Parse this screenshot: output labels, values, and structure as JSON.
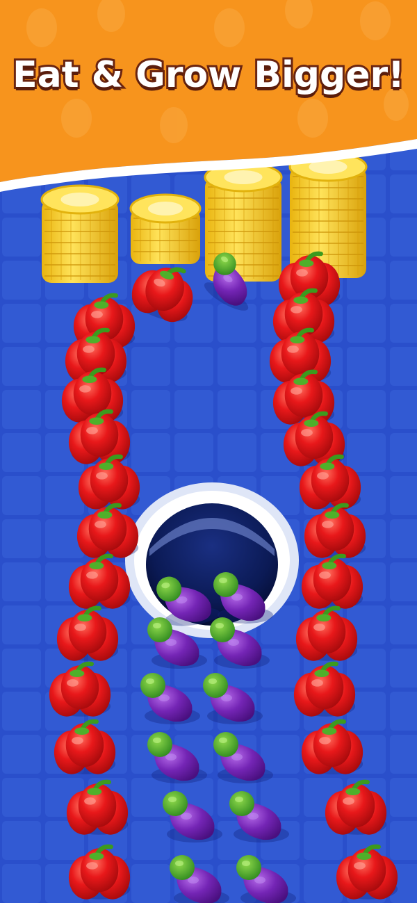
{
  "banner": {
    "headline": "Eat & Grow Bigger!",
    "background_color": "#f7941d",
    "stripe_color": "#ffffff",
    "text_color": "#ffffff",
    "outline_color": "#6a2410"
  },
  "board": {
    "floor_color": "#2f57d8",
    "tile_line_color": "#4169e6"
  },
  "hole": {
    "rim_color": "#f4f7ff",
    "inner_color": "#0d1e5c"
  },
  "items": {
    "corn_icon": "corn-icon",
    "pepper_icon": "red-bell-pepper-icon",
    "eggplant_icon": "eggplant-icon",
    "pepper_color": "#e21313",
    "eggplant_color": "#6a1ea3",
    "corn_color": "#f9d62e"
  }
}
